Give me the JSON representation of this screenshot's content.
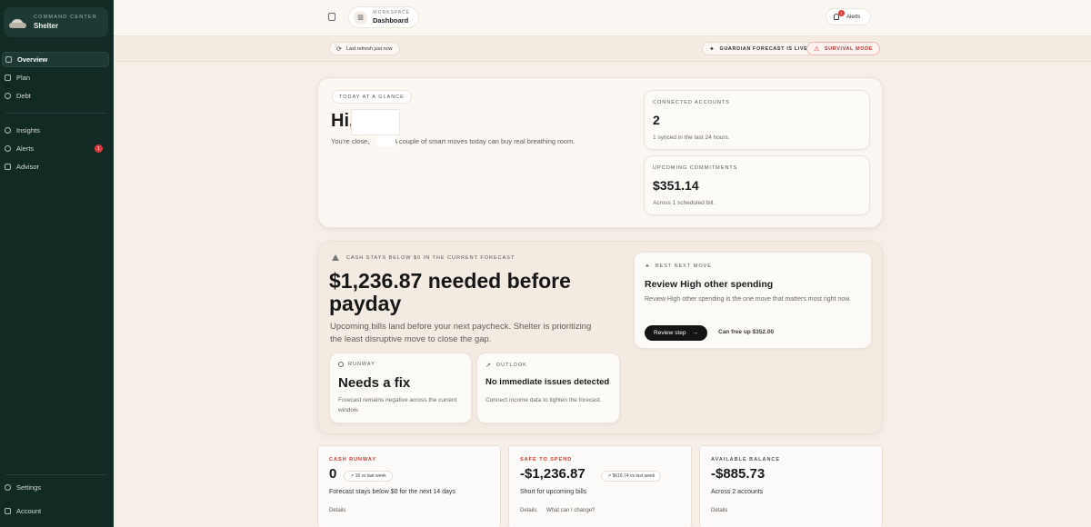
{
  "brand": {
    "eyebrow": "Command Center",
    "name": "Shelter"
  },
  "sidebar": {
    "items": [
      {
        "label": "Overview",
        "icon": "grid-icon",
        "active": true
      },
      {
        "label": "Plan",
        "icon": "calendar-icon"
      },
      {
        "label": "Debt",
        "icon": "target-icon"
      },
      {
        "label": "Insights",
        "icon": "lightbulb-icon"
      },
      {
        "label": "Alerts",
        "icon": "bell-icon",
        "badge": "1"
      },
      {
        "label": "Advisor",
        "icon": "chat-icon"
      }
    ],
    "footer": [
      {
        "label": "Settings",
        "icon": "gear-icon"
      },
      {
        "label": "Account",
        "icon": "logout-icon"
      }
    ]
  },
  "topbar": {
    "workspace_eyebrow": "Workspace",
    "workspace_name": "Dashboard",
    "alerts_label": "Alerts",
    "alerts_badge": "1"
  },
  "status": {
    "refresh": "Last refresh just now",
    "forecast_live": "Guardian forecast is live",
    "survival_mode": "Survival mode"
  },
  "glance": {
    "chip": "Today at a glance",
    "greeting": "Hi,",
    "sub_prefix": "You're close,",
    "sub_suffix": "A couple of smart moves today can buy real breathing room.",
    "connected_label": "Connected accounts",
    "connected_value": "2",
    "connected_note": "1 synced in the last 24 hours.",
    "commit_label": "Upcoming commitments",
    "commit_value": "$351.14",
    "commit_note": "Across 1 scheduled bill."
  },
  "forecast": {
    "warning": "Cash stays below $0 in the current forecast",
    "headline": "$1,236.87 needed before payday",
    "body": "Upcoming bills land before your next paycheck. Shelter is prioritizing the least disruptive move to close the gap.",
    "runway_label": "Runway",
    "runway_head": "Needs a fix",
    "runway_body": "Forecast remains negative across the current window.",
    "outlook_label": "Outlook",
    "outlook_head": "No immediate issues detected",
    "outlook_body": "Connect income data to tighten the forecast.",
    "move_label": "Best next move",
    "move_title": "Review High other spending",
    "move_body": "Review High other spending is the one move that matters most right now.",
    "move_button": "Review step",
    "move_free": "Can free up $352.00"
  },
  "kpis": [
    {
      "label": "Cash runway",
      "value": "0",
      "delta": "↗ 16 vs last week",
      "note": "Forecast stays below $0 for the next 14 days",
      "links": [
        "Details"
      ]
    },
    {
      "label": "Safe to spend",
      "value": "-$1,236.87",
      "delta": "↗ $616.74 vs last week",
      "note": "Short for upcoming bills",
      "links": [
        "Details",
        "What can I change?"
      ]
    },
    {
      "label": "Available balance",
      "value": "-$885.73",
      "note": "Across 2 accounts",
      "links": [
        "Details"
      ]
    }
  ],
  "colors": {
    "sidebar": "#122a24",
    "danger": "#d4372f",
    "background": "#f6efe8"
  }
}
